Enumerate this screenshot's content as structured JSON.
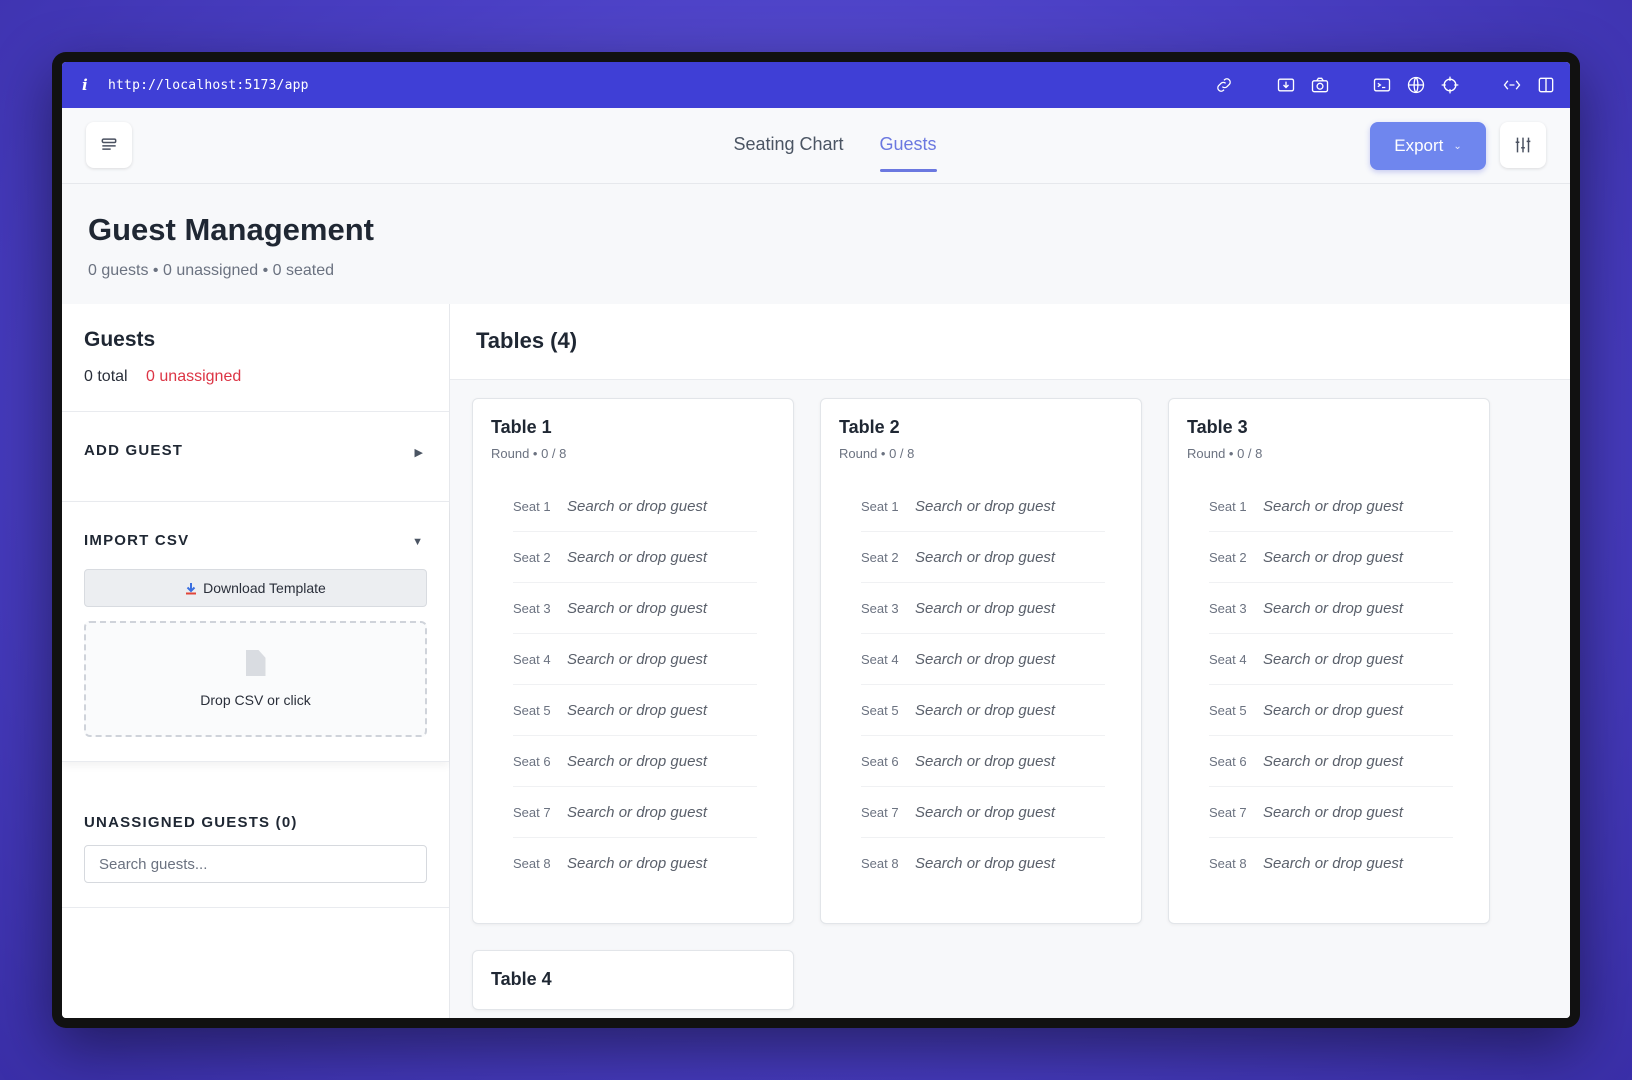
{
  "browser": {
    "info_glyph": "i",
    "url": "http://localhost:5173/app"
  },
  "header": {
    "tabs": [
      {
        "label": "Seating Chart",
        "active": false
      },
      {
        "label": "Guests",
        "active": true
      }
    ],
    "export_label": "Export"
  },
  "page": {
    "title": "Guest Management",
    "stats": "0 guests • 0 unassigned • 0 seated"
  },
  "sidebar": {
    "title": "Guests",
    "total": "0 total",
    "unassigned": "0 unassigned",
    "add_guest": {
      "title": "ADD GUEST",
      "arrow": "▶"
    },
    "import_csv": {
      "title": "IMPORT CSV",
      "arrow": "▼",
      "download_label": "Download Template",
      "drop_label": "Drop CSV or click"
    },
    "unassigned_section": {
      "title": "UNASSIGNED GUESTS (0)",
      "search_placeholder": "Search guests..."
    }
  },
  "main": {
    "title": "Tables (4)",
    "tables": [
      {
        "name": "Table 1",
        "meta": "Round • 0 / 8"
      },
      {
        "name": "Table 2",
        "meta": "Round • 0 / 8"
      },
      {
        "name": "Table 3",
        "meta": "Round • 0 / 8"
      },
      {
        "name": "Table 4",
        "meta": ""
      }
    ],
    "seat_labels": [
      "Seat 1",
      "Seat 2",
      "Seat 3",
      "Seat 4",
      "Seat 5",
      "Seat 6",
      "Seat 7",
      "Seat 8"
    ],
    "seat_placeholder": "Search or drop guest"
  },
  "colors": {
    "accent": "#6b78e0",
    "export_bg": "#6f86ee",
    "url_bar": "#3f3fd6",
    "unassigned_red": "#dc3545"
  },
  "icons": [
    "info-icon",
    "link-icon",
    "screenshot-icon",
    "camera-icon",
    "terminal-icon",
    "globe-icon",
    "crosshair-icon",
    "extension-icon",
    "split-view-icon",
    "menu-icon",
    "sliders-icon",
    "download-icon",
    "file-icon",
    "chevron-down-icon"
  ]
}
